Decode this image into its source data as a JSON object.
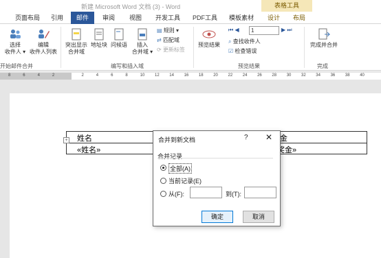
{
  "titlebar": {
    "title": "新建 Microsoft Word 文档 (3) - Word",
    "context_group": "表格工具"
  },
  "tabs": [
    "页面布局",
    "引用",
    "邮件",
    "审阅",
    "视图",
    "开发工具",
    "PDF工具",
    "模板素材",
    "设计",
    "布局"
  ],
  "active_tab": "邮件",
  "ribbon": {
    "start_merge": {
      "select_label": "选择",
      "select_sub": "收件人 ▾",
      "edit_label": "编辑",
      "edit_sub": "收件人列表",
      "group": "开始邮件合并"
    },
    "write_insert": {
      "highlight": "突出显示",
      "highlight_sub": "合并域",
      "address_block": "地址块",
      "greeting": "问候语",
      "insert": "插入",
      "insert_sub": "合并域 ▾",
      "rules": "规则 ▾",
      "match": "匹配域",
      "update": "更新标签",
      "group": "编写和插入域"
    },
    "preview": {
      "preview_label": "预览结果",
      "record": "1",
      "find": "查找收件人",
      "check": "检查错误",
      "group": "预览结果"
    },
    "finish": {
      "label": "完成并合并",
      "group": "完成"
    }
  },
  "ruler": {
    "ticks": [
      "8",
      "6",
      "4",
      "2",
      "",
      "2",
      "4",
      "6",
      "8",
      "10",
      "12",
      "14",
      "16",
      "18",
      "20",
      "22",
      "24",
      "26",
      "28",
      "30",
      "32",
      "34",
      "36",
      "38",
      "40"
    ]
  },
  "document": {
    "header_left": "姓名",
    "header_right": "金",
    "field_left": "«姓名»",
    "field_right": "奖金»"
  },
  "dialog": {
    "title": "合并到新文档",
    "help": "?",
    "close": "✕",
    "group": "合并记录",
    "opt_all": "全部(A)",
    "opt_current": "当前记录(E)",
    "opt_from": "从(F):",
    "to_label": "到(T):",
    "from_value": "",
    "to_value": "",
    "ok": "确定",
    "cancel": "取消"
  },
  "colors": {
    "accent": "#2b579a",
    "context": "#f5e7b8"
  }
}
